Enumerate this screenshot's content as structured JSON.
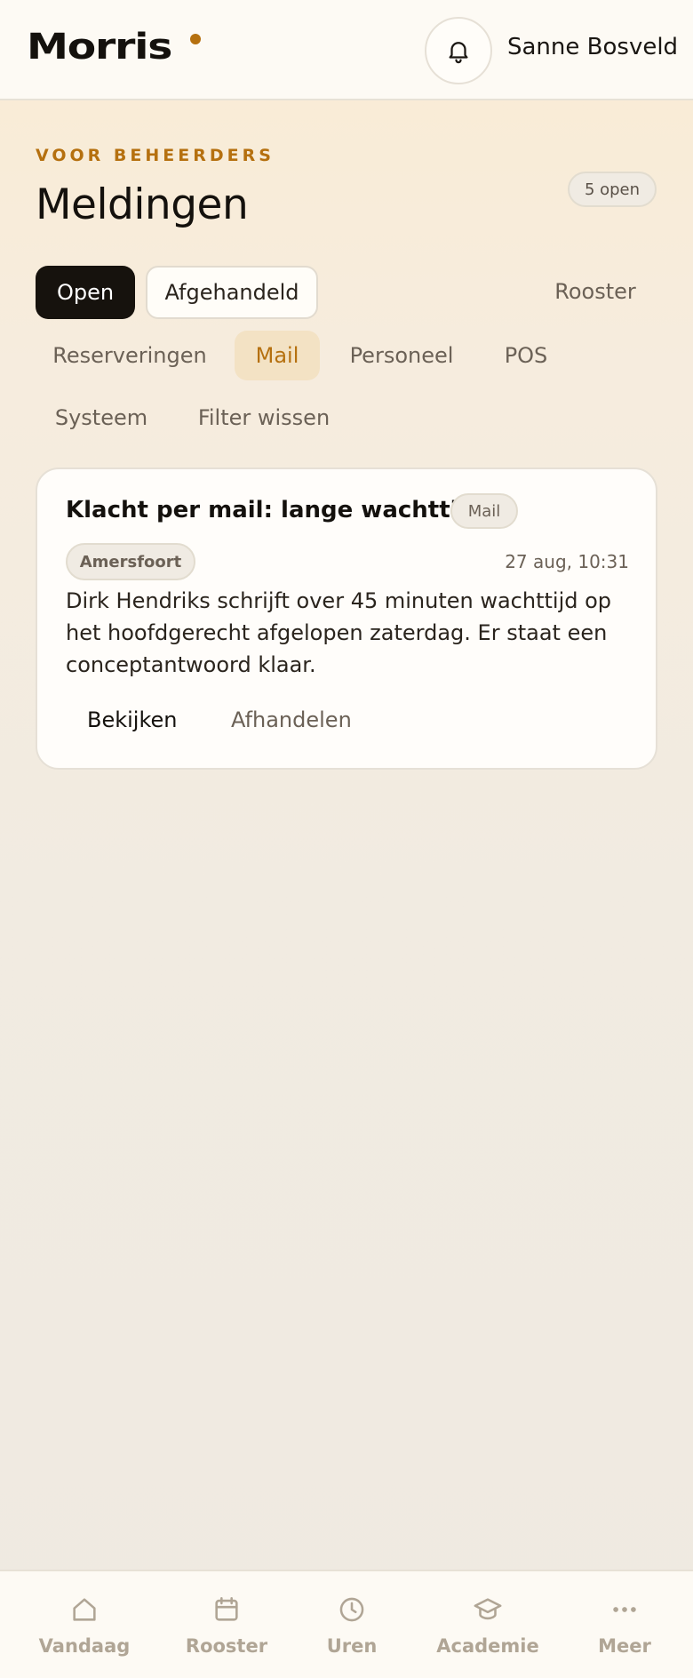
{
  "header": {
    "logo": "Morris",
    "user_name": "Sanne Bosveld",
    "bell_icon": "bell-icon"
  },
  "page": {
    "eyebrow": "VOOR BEHEERDERS",
    "title": "Meldingen",
    "open_count": "5 open"
  },
  "status_tabs": [
    {
      "label": "Open",
      "active": true
    },
    {
      "label": "Afgehandeld",
      "active": false
    }
  ],
  "filters": [
    {
      "label": "Rooster",
      "active": false
    },
    {
      "label": "Reserveringen",
      "active": false
    },
    {
      "label": "Mail",
      "active": true
    },
    {
      "label": "Personeel",
      "active": false
    },
    {
      "label": "POS",
      "active": false
    },
    {
      "label": "Systeem",
      "active": false
    },
    {
      "label": "Filter wissen",
      "active": false
    }
  ],
  "notification": {
    "title": "Klacht per mail: lange wachttijd",
    "tag": "Mail",
    "location": "Amersfoort",
    "timestamp": "27 aug, 10:31",
    "body": "Dirk Hendriks schrijft over 45 minuten wachttijd op het hoofdgerecht afgelopen zaterdag. Er staat een conceptantwoord klaar.",
    "actions": {
      "view": "Bekijken",
      "resolve": "Afhandelen"
    }
  },
  "bottom_nav": [
    {
      "label": "Vandaag",
      "icon": "home-icon"
    },
    {
      "label": "Rooster",
      "icon": "calendar-icon"
    },
    {
      "label": "Uren",
      "icon": "clock-icon"
    },
    {
      "label": "Academie",
      "icon": "graduation-cap-icon"
    },
    {
      "label": "Meer",
      "icon": "more-icon"
    }
  ],
  "colors": {
    "accent": "#b5700f",
    "dark": "#16120d",
    "muted": "#6b6156",
    "nav_muted": "#b0a595"
  }
}
